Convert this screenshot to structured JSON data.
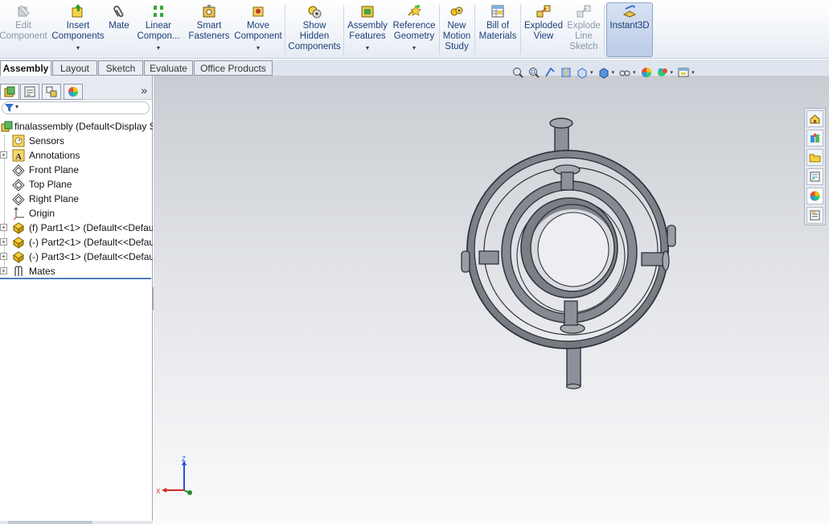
{
  "ribbon": {
    "buttons": [
      {
        "id": "edit-component",
        "label": "Edit\nComponent",
        "enabled": false,
        "dropdown": false
      },
      {
        "id": "insert-components",
        "label": "Insert\nComponents",
        "enabled": true,
        "dropdown": true
      },
      {
        "id": "mate",
        "label": "Mate",
        "enabled": true,
        "dropdown": false
      },
      {
        "id": "linear-component-pattern",
        "label": "Linear\nCompon...",
        "enabled": true,
        "dropdown": true
      },
      {
        "id": "smart-fasteners",
        "label": "Smart\nFasteners",
        "enabled": true,
        "dropdown": false
      },
      {
        "id": "move-component",
        "label": "Move\nComponent",
        "enabled": true,
        "dropdown": true
      },
      {
        "id": "show-hidden-components",
        "label": "Show\nHidden\nComponents",
        "enabled": true,
        "dropdown": false
      },
      {
        "id": "assembly-features",
        "label": "Assembly\nFeatures",
        "enabled": true,
        "dropdown": true
      },
      {
        "id": "reference-geometry",
        "label": "Reference\nGeometry",
        "enabled": true,
        "dropdown": true
      },
      {
        "id": "new-motion-study",
        "label": "New\nMotion\nStudy",
        "enabled": true,
        "dropdown": false
      },
      {
        "id": "bill-of-materials",
        "label": "Bill of\nMaterials",
        "enabled": true,
        "dropdown": false
      },
      {
        "id": "exploded-view",
        "label": "Exploded\nView",
        "enabled": true,
        "dropdown": false
      },
      {
        "id": "explode-line-sketch",
        "label": "Explode\nLine\nSketch",
        "enabled": false,
        "dropdown": false
      },
      {
        "id": "instant3d",
        "label": "Instant3D",
        "enabled": true,
        "dropdown": false,
        "active": true
      }
    ]
  },
  "tabs": [
    "Assembly",
    "Layout",
    "Sketch",
    "Evaluate",
    "Office Products"
  ],
  "selected_tab": "Assembly",
  "panel": {
    "collapse_glyph": "»",
    "tree": [
      {
        "label": "finalassembly  (Default<Display S",
        "icon": "assembly-icon",
        "expandable": false
      },
      {
        "label": "Sensors",
        "icon": "sensors-icon",
        "expandable": false
      },
      {
        "label": "Annotations",
        "icon": "annotations-icon",
        "expandable": true
      },
      {
        "label": "Front Plane",
        "icon": "plane-icon",
        "expandable": false
      },
      {
        "label": "Top Plane",
        "icon": "plane-icon",
        "expandable": false
      },
      {
        "label": "Right Plane",
        "icon": "plane-icon",
        "expandable": false
      },
      {
        "label": "Origin",
        "icon": "origin-icon",
        "expandable": false
      },
      {
        "label": "(f) Part1<1> (Default<<Defau",
        "icon": "part-icon",
        "expandable": true
      },
      {
        "label": "(-) Part2<1> (Default<<Defau",
        "icon": "part-icon",
        "expandable": true
      },
      {
        "label": "(-) Part3<1> (Default<<Defau",
        "icon": "part-icon",
        "expandable": true
      },
      {
        "label": "Mates",
        "icon": "mates-icon",
        "expandable": true
      }
    ]
  },
  "triad": {
    "z": "Z",
    "x": "X"
  },
  "colors": {
    "accent": "#4e7ec4",
    "model": "#8d9098",
    "viewport_top": "#c9ccd2",
    "viewport_bottom": "#fbfbfc"
  }
}
